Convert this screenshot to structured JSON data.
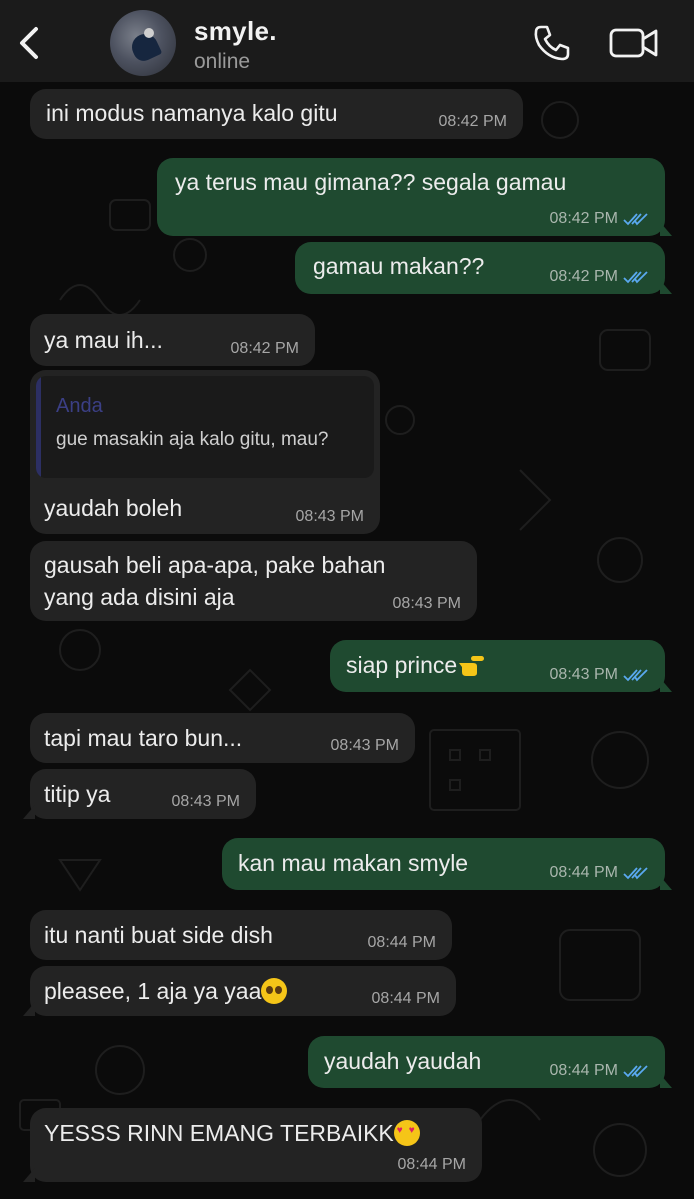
{
  "header": {
    "contact_name": "smyle.",
    "status": "online"
  },
  "colors": {
    "incoming_bubble": "#232323",
    "outgoing_bubble": "#1f4a30",
    "read_tick": "#5aa9f0",
    "background": "#0b0b0b"
  },
  "messages": [
    {
      "dir": "in",
      "text": "ini modus namanya kalo gitu",
      "time": "08:42 PM"
    },
    {
      "dir": "out",
      "text": "ya terus mau gimana?? segala gamau",
      "time": "08:42 PM"
    },
    {
      "dir": "out",
      "text": "gamau makan??",
      "time": "08:42 PM"
    },
    {
      "dir": "in",
      "text": "ya mau ih...",
      "time": "08:42 PM"
    },
    {
      "dir": "in",
      "text": "yaudah boleh",
      "time": "08:43 PM",
      "quote_name": "Anda",
      "quote_text": "gue masakin aja kalo gitu, mau?"
    },
    {
      "dir": "in",
      "text": "gausah beli apa-apa, pake bahan\nyang ada disini aja",
      "time": "08:43 PM"
    },
    {
      "dir": "out",
      "text": "siap prince",
      "time": "08:43 PM"
    },
    {
      "dir": "in",
      "text": "tapi mau taro bun...",
      "time": "08:43 PM"
    },
    {
      "dir": "in",
      "text": "titip ya",
      "time": "08:43 PM"
    },
    {
      "dir": "out",
      "text": "kan mau makan smyle",
      "time": "08:44 PM"
    },
    {
      "dir": "in",
      "text": "itu nanti buat side dish",
      "time": "08:44 PM"
    },
    {
      "dir": "in",
      "text": "pleasee, 1 aja ya yaa",
      "time": "08:44 PM"
    },
    {
      "dir": "out",
      "text": "yaudah yaudah",
      "time": "08:44 PM"
    },
    {
      "dir": "in",
      "text": "YESSS RINN EMANG TERBAIKK",
      "time": "08:44 PM"
    }
  ]
}
